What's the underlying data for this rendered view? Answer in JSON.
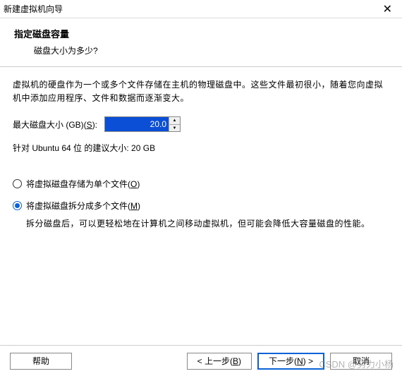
{
  "window": {
    "title": "新建虚拟机向导"
  },
  "header": {
    "title": "指定磁盘容量",
    "subtitle": "磁盘大小为多少?"
  },
  "content": {
    "description": "虚拟机的硬盘作为一个或多个文件存储在主机的物理磁盘中。这些文件最初很小，随着您向虚拟机中添加应用程序、文件和数据而逐渐变大。",
    "disk_size_label": "最大磁盘大小 (GB)(",
    "disk_size_hotkey": "S",
    "disk_size_label_end": "):",
    "disk_size_value": "20.0",
    "recommendation": "针对 Ubuntu 64 位 的建议大小: 20 GB"
  },
  "radios": {
    "single": {
      "label_pre": "将虚拟磁盘存储为单个文件(",
      "hotkey": "O",
      "label_post": ")"
    },
    "split": {
      "label_pre": "将虚拟磁盘拆分成多个文件(",
      "hotkey": "M",
      "label_post": ")",
      "desc": "拆分磁盘后，可以更轻松地在计算机之间移动虚拟机，但可能会降低大容量磁盘的性能。"
    }
  },
  "footer": {
    "help": "帮助",
    "back_pre": "< 上一步(",
    "back_hot": "B",
    "back_post": ")",
    "next_pre": "下一步(",
    "next_hot": "N",
    "next_post": ") >",
    "cancel": "取消"
  },
  "watermark": "CSDN @努力小杨"
}
